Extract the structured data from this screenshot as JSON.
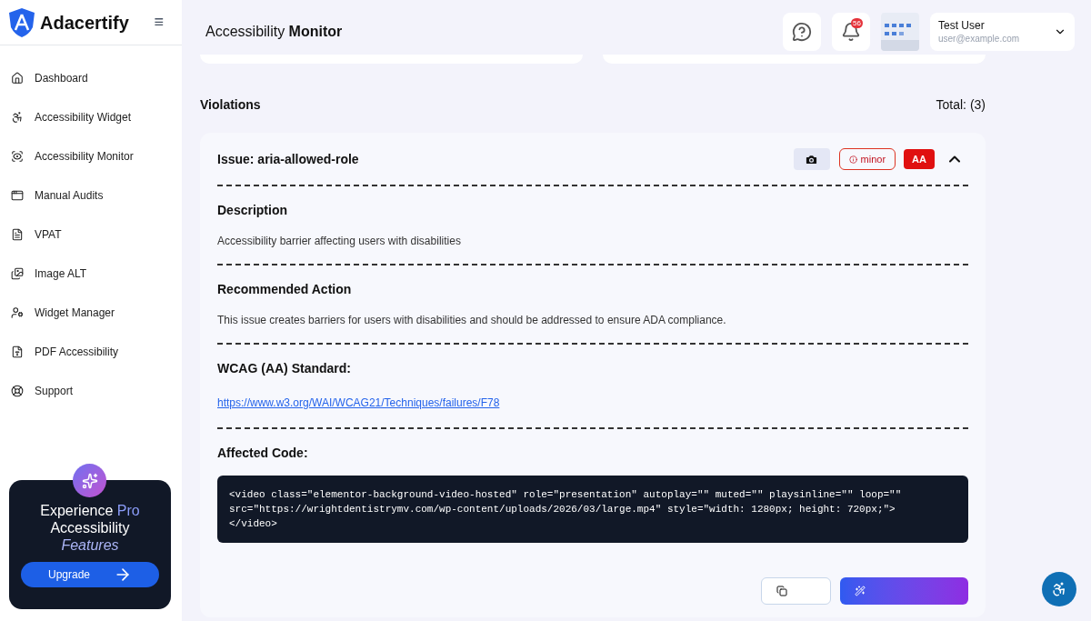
{
  "brand": {
    "name": "Adacertify",
    "menu_glyph": "≡"
  },
  "sidebar": {
    "items": [
      {
        "label": "Dashboard",
        "selected": false
      },
      {
        "label": "Accessibility Widget",
        "selected": false
      },
      {
        "label": "Accessibility Monitor",
        "selected": false
      },
      {
        "label": "Manual Audits",
        "selected": false
      },
      {
        "label": "VPAT",
        "selected": false
      },
      {
        "label": "Image ALT",
        "selected": false
      },
      {
        "label": "Widget Manager",
        "selected": false
      },
      {
        "label": "PDF Accessibility",
        "selected": false
      },
      {
        "label": "Support",
        "selected": false
      }
    ]
  },
  "promo": {
    "line1": "Experience **Pro**",
    "line2": "Accessibility",
    "line3": "Features",
    "button": "Upgrade"
  },
  "header": {
    "title": "Accessibility **Monitor**",
    "notification_count": "56",
    "user": {
      "name": "Test User",
      "email": "user@example.com"
    }
  },
  "violations": {
    "title": "Violations",
    "total": "Total: (3)",
    "issue": {
      "title": "Issue: aria-allowed-role",
      "severity": "minor",
      "level": "AA",
      "expanded": true,
      "sections": [
        {
          "kind": "text",
          "heading": "Description",
          "body": "Accessibility barrier affecting users with disabilities"
        },
        {
          "kind": "text",
          "heading": "Recommended Action",
          "body": "This issue creates barriers for users with disabilities and should be addressed to ensure ADA compliance."
        },
        {
          "kind": "link",
          "heading": "WCAG (AA) Standard:",
          "body": "https://www.w3.org/WAI/WCAG21/Techniques/failures/F78"
        },
        {
          "kind": "code",
          "heading": "Affected Code:",
          "body": "<video class=\"elementor-background-video-hosted\" role=\"presentation\" autoplay=\"\" muted=\"\" playsinline=\"\" loop=\"\"\nsrc=\"https://wrightdentistrymv.com/wp-content/uploads/2026/03/large.mp4\" style=\"width: 1280px; height: 720px;\">\n</video>"
        }
      ]
    }
  }
}
